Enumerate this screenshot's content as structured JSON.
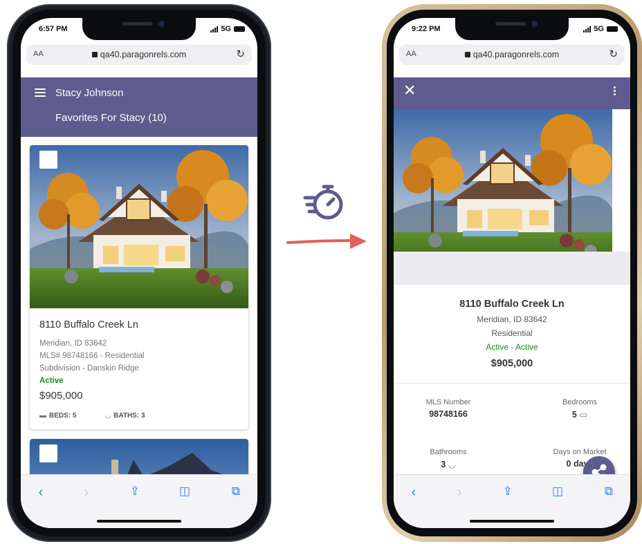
{
  "left_phone": {
    "status": {
      "time": "6:57 PM",
      "network": "5G"
    },
    "browser": {
      "aa_label": "AA",
      "url": "qa40.paragonrels.com"
    },
    "header": {
      "user_name": "Stacy Johnson",
      "favorites_title": "Favorites For Stacy (10)"
    },
    "listing": {
      "address": "8110 Buffalo Creek Ln",
      "city_line": "Meridian, ID 83642",
      "mls_line": "MLS# 98748166 - Residential",
      "subdivision_line": "Subdivision - Danskin Ridge",
      "status": "Active",
      "price": "$905,000",
      "beds_label": "BEDS: 5",
      "baths_label": "BATHS: 3"
    },
    "toolbar_icons": [
      "back-icon",
      "forward-icon",
      "share-icon",
      "bookmarks-icon",
      "tabs-icon"
    ]
  },
  "right_phone": {
    "status": {
      "time": "9:22 PM",
      "network": "5G"
    },
    "browser": {
      "aa_label": "AA",
      "url": "qa40.paragonrels.com"
    },
    "listing": {
      "address": "8110 Buffalo Creek Ln",
      "city_line": "Meridian, ID 83642",
      "type": "Residential",
      "status": "Active - Active",
      "price": "$905,000"
    },
    "stats": {
      "mls_label": "MLS Number",
      "mls_value": "98748166",
      "bedrooms_label": "Bedrooms",
      "bedrooms_value": "5",
      "bathrooms_label": "Bathrooms",
      "bathrooms_value": "3",
      "dom_label": "Days on Market",
      "dom_value": "0 days"
    },
    "toolbar_icons": [
      "back-icon",
      "forward-icon",
      "share-icon",
      "bookmarks-icon",
      "tabs-icon"
    ]
  },
  "colors": {
    "brand_header": "#5e5b8e",
    "active_status": "#1a8f1a",
    "arrow": "#e0605a",
    "timer_icon": "#5e5b8e",
    "safari_blue": "#2f7bf6"
  }
}
